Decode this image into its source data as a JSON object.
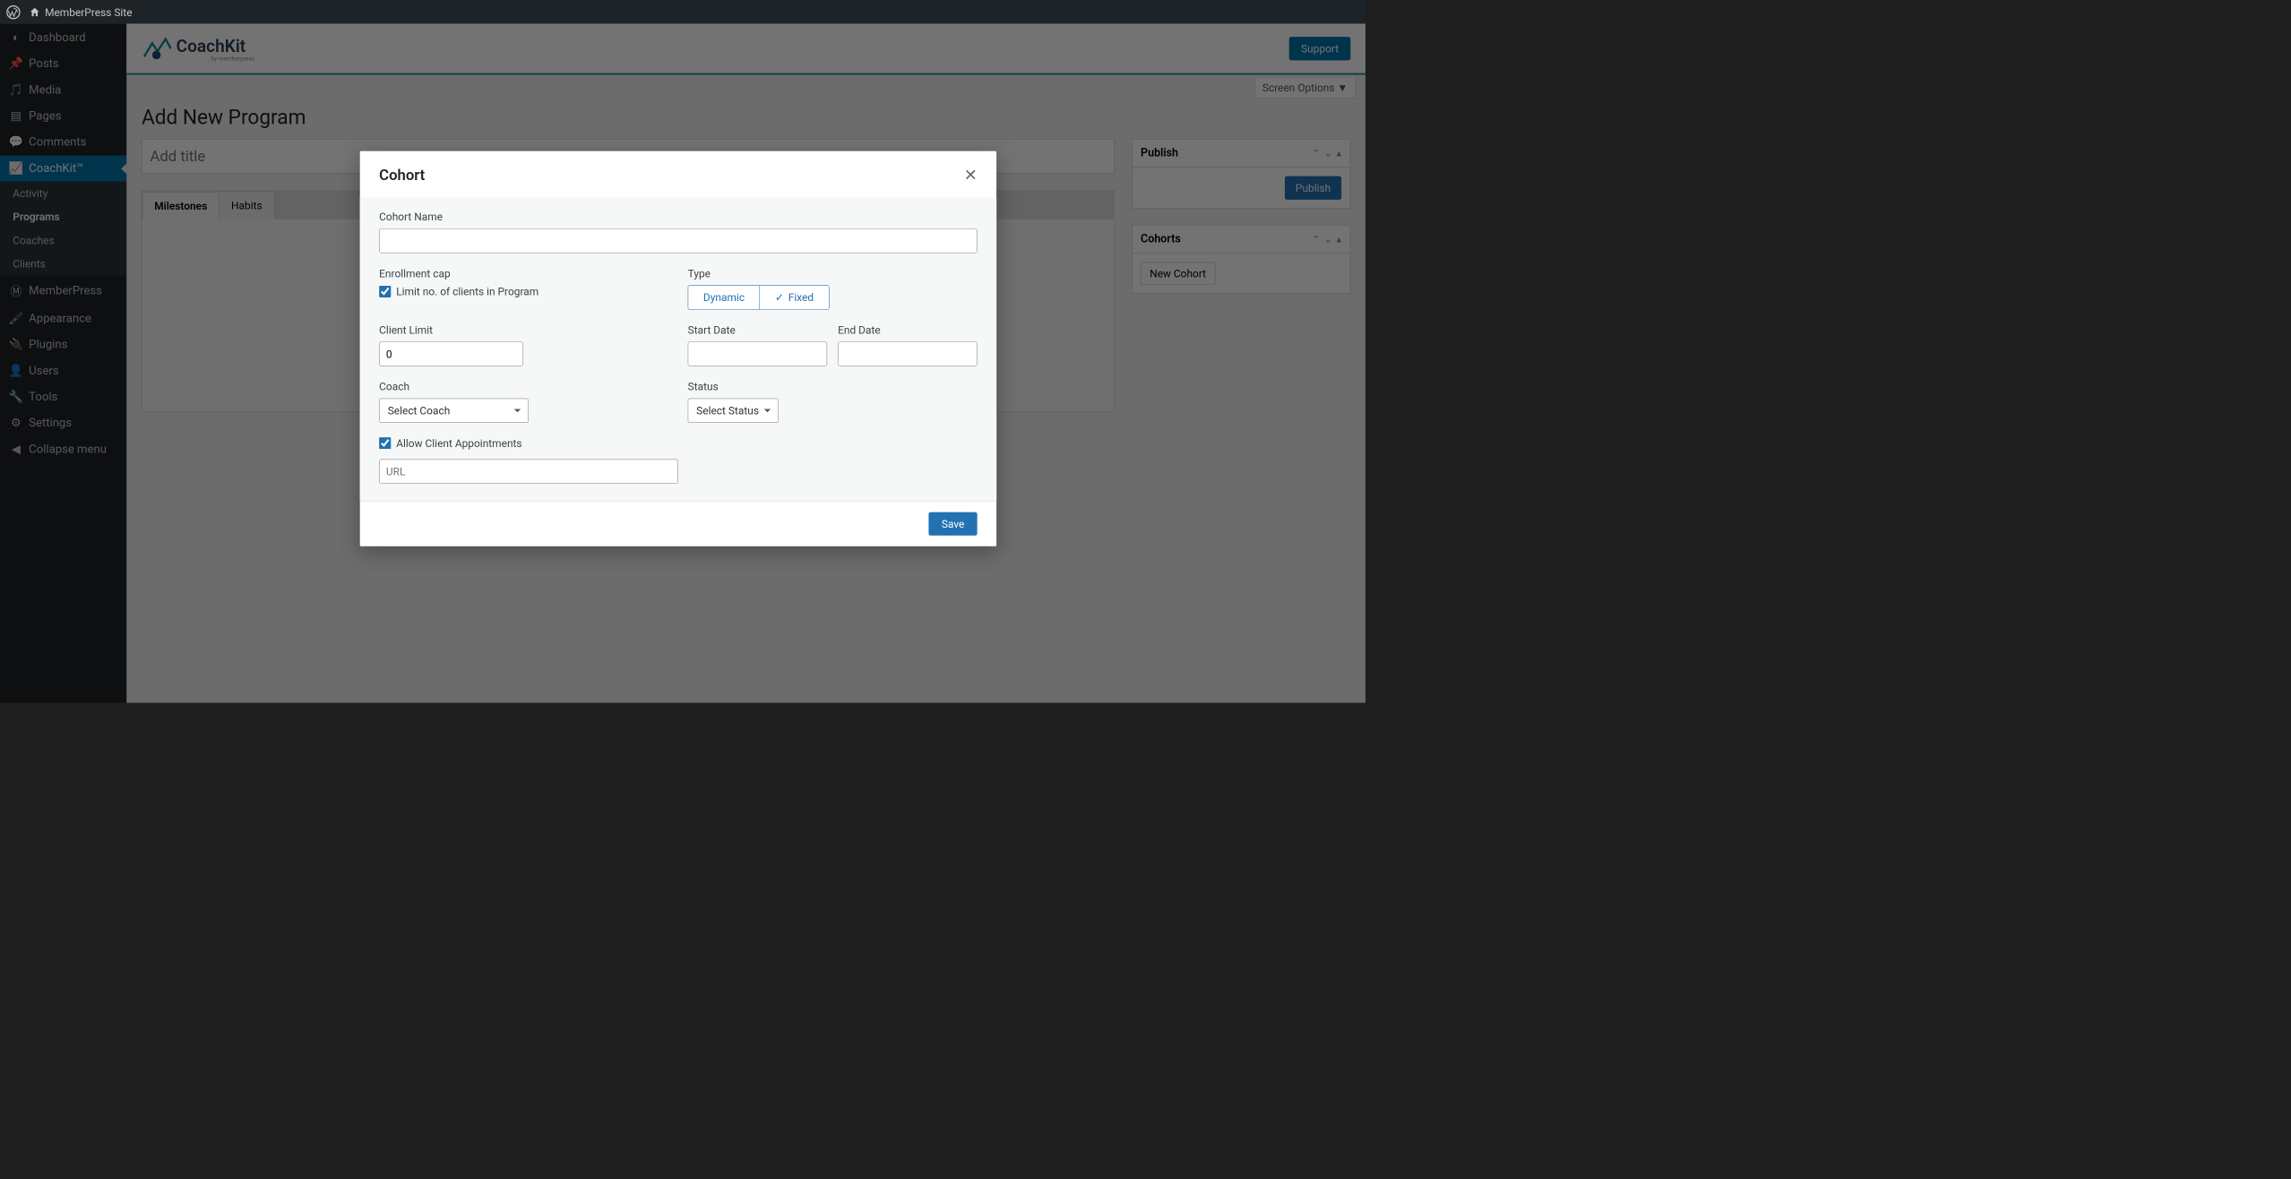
{
  "admin_bar": {
    "site_name": "MemberPress Site"
  },
  "sidebar": {
    "items": [
      {
        "label": "Dashboard",
        "icon": "dashboard"
      },
      {
        "label": "Posts",
        "icon": "pin"
      },
      {
        "label": "Media",
        "icon": "media"
      },
      {
        "label": "Pages",
        "icon": "pages"
      },
      {
        "label": "Comments",
        "icon": "comments"
      },
      {
        "label": "CoachKit™",
        "icon": "chart",
        "active": true
      },
      {
        "label": "MemberPress",
        "icon": "mp"
      },
      {
        "label": "Appearance",
        "icon": "brush"
      },
      {
        "label": "Plugins",
        "icon": "plug"
      },
      {
        "label": "Users",
        "icon": "user"
      },
      {
        "label": "Tools",
        "icon": "wrench"
      },
      {
        "label": "Settings",
        "icon": "settings"
      },
      {
        "label": "Collapse menu",
        "icon": "collapse"
      }
    ],
    "submenu": [
      {
        "label": "Activity"
      },
      {
        "label": "Programs",
        "active": true
      },
      {
        "label": "Coaches"
      },
      {
        "label": "Clients"
      }
    ]
  },
  "brand": {
    "name": "CoachKit",
    "tagline": "by memberpress",
    "support": "Support"
  },
  "screen_options": "Screen Options",
  "page_title": "Add New Program",
  "title_placeholder": "Add title",
  "tabs": {
    "milestones": "Milestones",
    "habits": "Habits"
  },
  "publish_box": {
    "title": "Publish",
    "button": "Publish"
  },
  "cohorts_box": {
    "title": "Cohorts",
    "new_button": "New Cohort"
  },
  "modal": {
    "title": "Cohort",
    "cohort_name_label": "Cohort Name",
    "enrollment_cap_label": "Enrollment cap",
    "limit_checkbox": "Limit no. of clients in Program",
    "type_label": "Type",
    "type_dynamic": "Dynamic",
    "type_fixed": "Fixed",
    "client_limit_label": "Client Limit",
    "client_limit_value": "0",
    "start_date_label": "Start Date",
    "end_date_label": "End Date",
    "coach_label": "Coach",
    "coach_select": "Select Coach",
    "status_label": "Status",
    "status_select": "Select Status",
    "allow_appts": "Allow Client Appointments",
    "url_placeholder": "URL",
    "save": "Save"
  }
}
